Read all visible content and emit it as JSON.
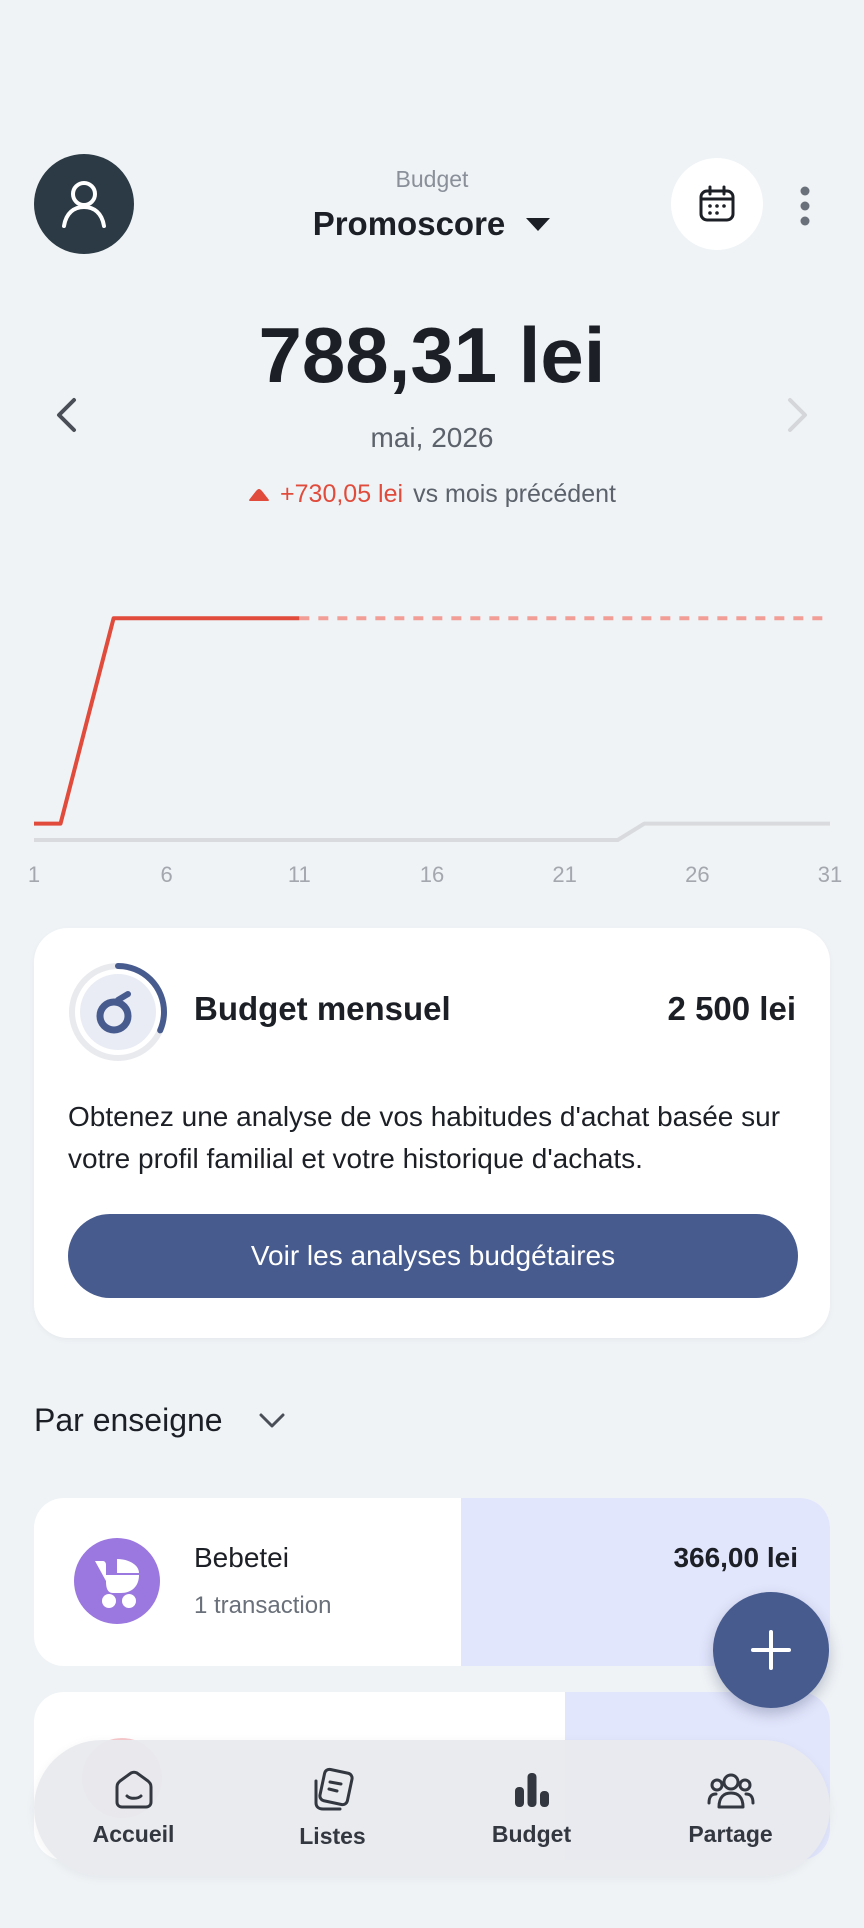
{
  "header": {
    "subtitle": "Budget",
    "title": "Promoscore"
  },
  "summary": {
    "amount": "788,31 lei",
    "period": "mai, 2026",
    "delta_value": "+730,05 lei",
    "delta_text": "vs mois précédent"
  },
  "chart_data": {
    "type": "line",
    "x_ticks": [
      "1",
      "6",
      "11",
      "16",
      "21",
      "26",
      "31"
    ],
    "series": [
      {
        "style": "solid",
        "color": "#e04b3c",
        "x": [
          1,
          2,
          3,
          4,
          11
        ],
        "y": [
          58.26,
          58.26,
          424.31,
          788.31,
          788.31
        ]
      },
      {
        "style": "dashed",
        "color": "#f29e96",
        "x": [
          11,
          31
        ],
        "y": [
          788.31,
          788.31
        ]
      },
      {
        "style": "solid",
        "color": "#d9dadd",
        "x": [
          1,
          23,
          24,
          31
        ],
        "y": [
          0,
          0,
          58.26,
          58.26
        ]
      }
    ],
    "ylim": [
      0,
      960
    ],
    "xlim": [
      1,
      31
    ]
  },
  "budget_card": {
    "title": "Budget mensuel",
    "amount": "2 500 lei",
    "progress": 0.315,
    "description": "Obtenez une analyse de vos habitudes d'achat basée sur votre profil familial et votre historique d'achats.",
    "button_label": "Voir les analyses budgétaires"
  },
  "section": {
    "title": "Par enseigne"
  },
  "merchants": [
    {
      "name": "Bebetei",
      "count": "1 transaction",
      "amount": "366,00 lei",
      "share": 0.464
    },
    {
      "share": 0.333
    }
  ],
  "nav": {
    "items": [
      {
        "label": "Accueil"
      },
      {
        "label": "Listes"
      },
      {
        "label": "Budget"
      },
      {
        "label": "Partage"
      }
    ]
  },
  "colors": {
    "accent": "#475b8f",
    "negative": "#e04b3c",
    "background": "#eff3f6"
  }
}
